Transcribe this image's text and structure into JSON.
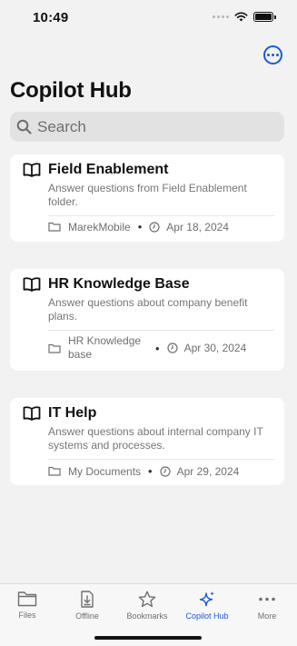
{
  "status_bar": {
    "time": "10:49"
  },
  "header": {
    "title": "Copilot Hub",
    "more_icon": "ellipsis-circle-icon"
  },
  "search": {
    "placeholder": "Search"
  },
  "cards": [
    {
      "title": "Field Enablement",
      "description": "Answer questions from Field Enablement folder.",
      "location": "MarekMobile",
      "date": "Apr 18, 2024"
    },
    {
      "title": "HR Knowledge Base",
      "description": "Answer questions about company benefit plans.",
      "location": "HR Knowledge base",
      "date": "Apr 30, 2024"
    },
    {
      "title": "IT Help",
      "description": "Answer questions about internal company IT systems and processes.",
      "location": "My Documents",
      "date": "Apr 29, 2024"
    }
  ],
  "tabs": [
    {
      "label": "Files",
      "icon": "folder-icon"
    },
    {
      "label": "Offline",
      "icon": "offline-download-icon"
    },
    {
      "label": "Bookmarks",
      "icon": "star-icon"
    },
    {
      "label": "Copilot Hub",
      "icon": "sparkle-icon",
      "active": true
    },
    {
      "label": "More",
      "icon": "more-dots-icon"
    }
  ],
  "colors": {
    "accent": "#1f57d6",
    "background": "#f2f2f2",
    "card": "#ffffff"
  }
}
